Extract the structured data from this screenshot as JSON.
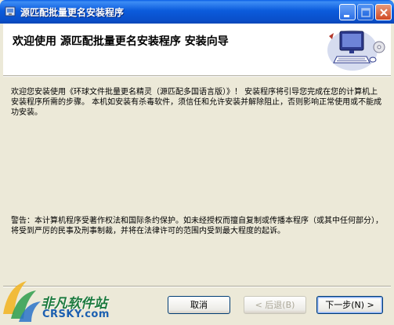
{
  "window": {
    "title": "源匹配批量更名安装程序"
  },
  "banner": {
    "title": "欢迎使用 源匹配批量更名安装程序 安装向导"
  },
  "content": {
    "intro": "欢迎您安装使用《环球文件批量更名精灵（源匹配多国语言版）》！ 安装程序将引导您完成在您的计算机上安装程序所需的步骤。 本机如安装有杀毒软件，须信任和允许安装并解除阻止，否则影响正常使用或不能成功安装。",
    "warning": "警告：本计算机程序受著作权法和国际条约保护。如未经授权而擅自复制或传播本程序（或其中任何部分），将受到严厉的民事及刑事制裁，并将在法律许可的范围内受到最大程度的起诉。"
  },
  "buttons": {
    "cancel": "取消",
    "back": "< 后退(B)",
    "next": "下一步(N) >"
  },
  "watermark": {
    "cn": "非凡软件站",
    "en": "CRSKY.com"
  },
  "colors": {
    "titlebar": "#0A5FE6",
    "face": "#ECE9D8"
  }
}
